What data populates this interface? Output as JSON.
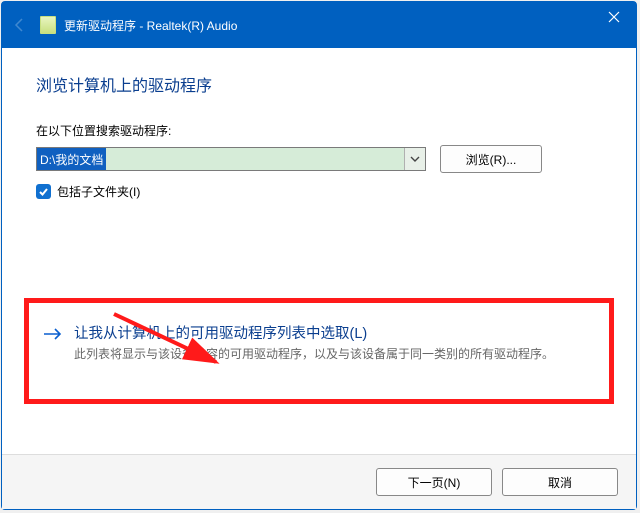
{
  "titlebar": {
    "title": "更新驱动程序 - Realtek(R) Audio"
  },
  "heading": "浏览计算机上的驱动程序",
  "search_label": "在以下位置搜索驱动程序:",
  "path_value": "D:\\我的文档",
  "browse_label": "浏览(R)...",
  "include_sub_label": "包括子文件夹(I)",
  "include_sub_checked": true,
  "pick_option": {
    "title": "让我从计算机上的可用驱动程序列表中选取(L)",
    "desc": "此列表将显示与该设备兼容的可用驱动程序，以及与该设备属于同一类别的所有驱动程序。"
  },
  "footer": {
    "next": "下一页(N)",
    "cancel": "取消"
  }
}
